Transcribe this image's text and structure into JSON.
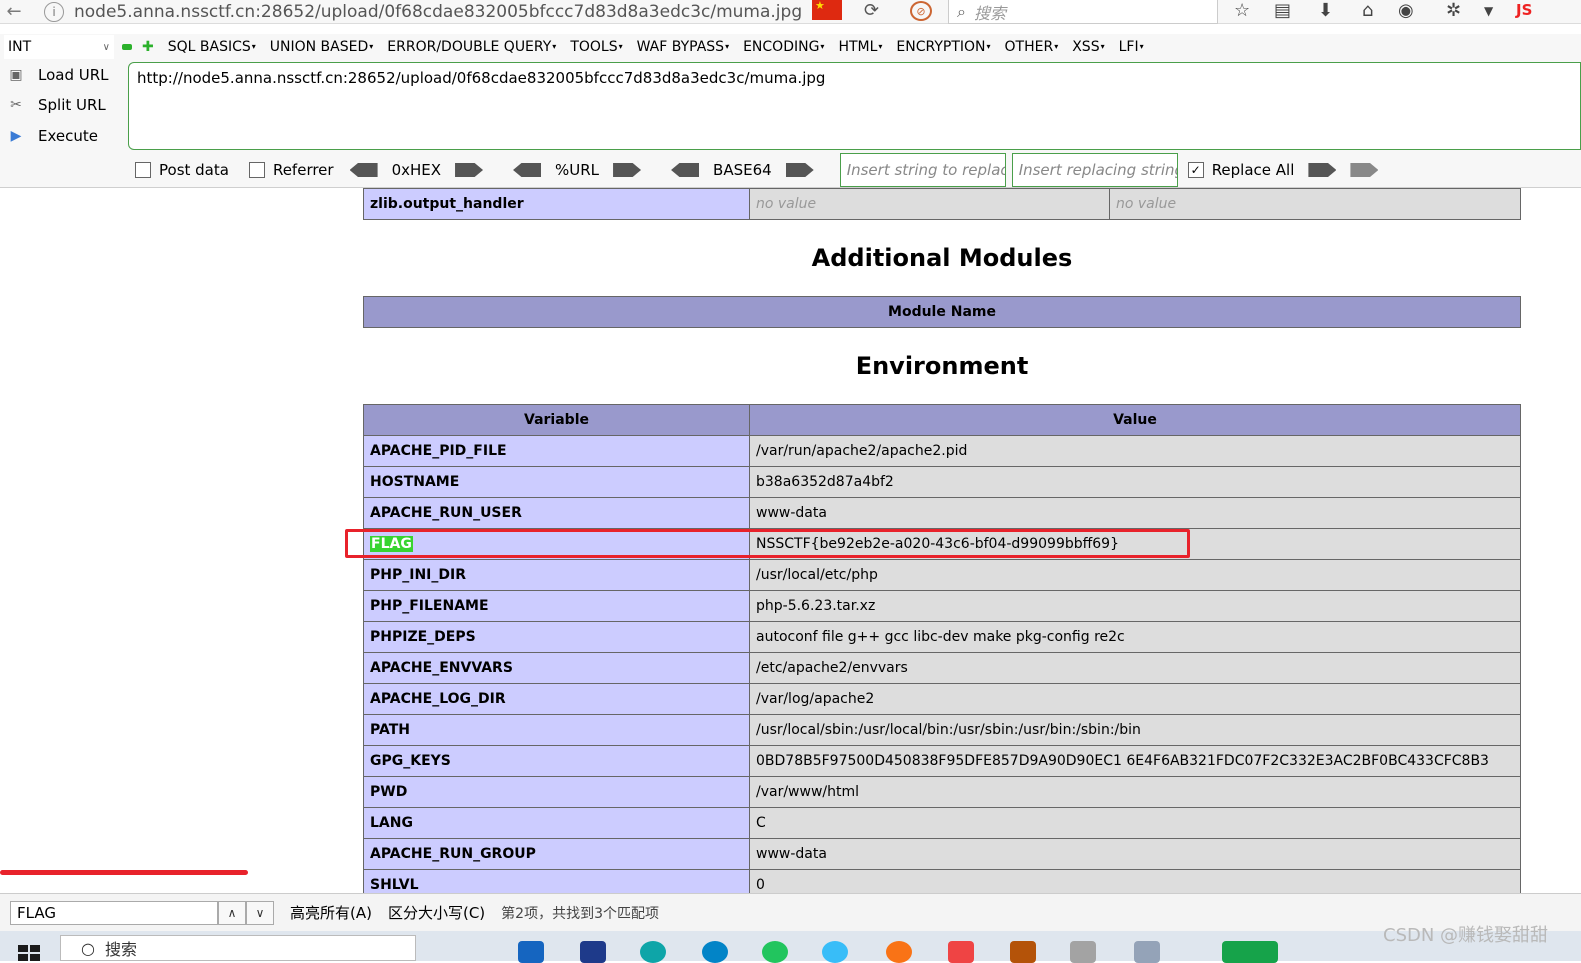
{
  "browser": {
    "url": "node5.anna.nssctf.cn:28652/upload/0f68cdae832005bfccc7d83d8a3edc3c/muma.jpg",
    "search_placeholder": "搜索",
    "js_label": "JS"
  },
  "hackbar": {
    "select_value": "INT",
    "menu": [
      "SQL BASICS",
      "UNION BASED",
      "ERROR/DOUBLE QUERY",
      "TOOLS",
      "WAF BYPASS",
      "ENCODING",
      "HTML",
      "ENCRYPTION",
      "OTHER",
      "XSS",
      "LFI"
    ],
    "load_url": "Load URL",
    "split_url": "Split URL",
    "execute": "Execute",
    "textarea_value": "http://node5.anna.nssctf.cn:28652/upload/0f68cdae832005bfccc7d83d8a3edc3c/muma.jpg",
    "post_data": "Post data",
    "referrer": "Referrer",
    "hex": "0xHEX",
    "url_enc": "%URL",
    "base64": "BASE64",
    "replace_placeholder": "Insert string to replace",
    "replacing_placeholder": "Insert replacing string",
    "replace_all": "Replace All"
  },
  "page": {
    "zlib_row": {
      "name": "zlib.output_handler",
      "local": "no value",
      "master": "no value"
    },
    "modules_title": "Additional Modules",
    "modules_header": "Module Name",
    "env_title": "Environment",
    "env_headers": [
      "Variable",
      "Value"
    ],
    "env_rows": [
      {
        "name": "APACHE_PID_FILE",
        "value": "/var/run/apache2/apache2.pid"
      },
      {
        "name": "HOSTNAME",
        "value": "b38a6352d87a4bf2"
      },
      {
        "name": "APACHE_RUN_USER",
        "value": "www-data"
      },
      {
        "name": "FLAG",
        "value": "NSSCTF{be92eb2e-a020-43c6-bf04-d99099bbff69}"
      },
      {
        "name": "PHP_INI_DIR",
        "value": "/usr/local/etc/php"
      },
      {
        "name": "PHP_FILENAME",
        "value": "php-5.6.23.tar.xz"
      },
      {
        "name": "PHPIZE_DEPS",
        "value": "autoconf file g++ gcc libc-dev make pkg-config re2c"
      },
      {
        "name": "APACHE_ENVVARS",
        "value": "/etc/apache2/envvars"
      },
      {
        "name": "APACHE_LOG_DIR",
        "value": "/var/log/apache2"
      },
      {
        "name": "PATH",
        "value": "/usr/local/sbin:/usr/local/bin:/usr/sbin:/usr/bin:/sbin:/bin"
      },
      {
        "name": "GPG_KEYS",
        "value": "0BD78B5F97500D450838F95DFE857D9A90D90EC1 6E4F6AB321FDC07F2C332E3AC2BF0BC433CFC8B3"
      },
      {
        "name": "PWD",
        "value": "/var/www/html"
      },
      {
        "name": "LANG",
        "value": "C"
      },
      {
        "name": "APACHE_RUN_GROUP",
        "value": "www-data"
      },
      {
        "name": "SHLVL",
        "value": "0"
      }
    ]
  },
  "findbar": {
    "query": "FLAG",
    "highlight_all": "高亮所有(A)",
    "match_case": "区分大小写(C)",
    "status": "第2项，共找到3个匹配项"
  },
  "taskbar": {
    "search_text": "搜索"
  },
  "watermark": "CSDN @赚钱娶甜甜",
  "colors": {
    "header_bg": "#9999cc",
    "label_bg": "#ccccff",
    "value_bg": "#dddddd",
    "highlight": "#38d430",
    "annotation_red": "#e8222b"
  }
}
